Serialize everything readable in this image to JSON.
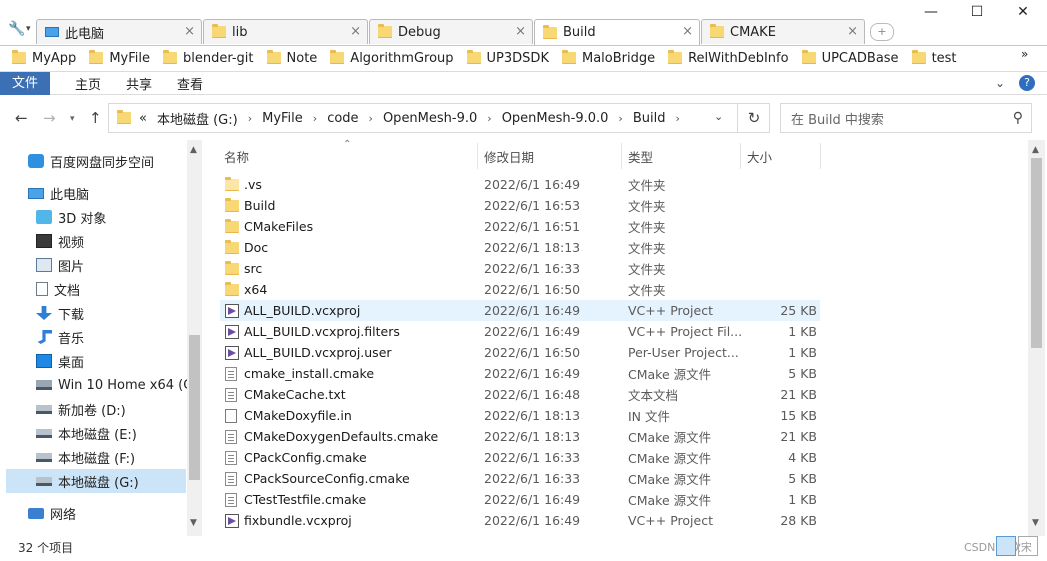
{
  "tabs": [
    {
      "label": "此电脑",
      "active": false,
      "icon": "computer-icon"
    },
    {
      "label": "lib",
      "active": false,
      "icon": "folder-icon"
    },
    {
      "label": "Debug",
      "active": false,
      "icon": "folder-icon"
    },
    {
      "label": "Build",
      "active": true,
      "icon": "folder-icon"
    },
    {
      "label": "CMAKE",
      "active": false,
      "icon": "folder-icon"
    }
  ],
  "window_controls": {
    "minimize": "—",
    "maximize": "☐",
    "close": "✕"
  },
  "bookmarks": [
    "MyApp",
    "MyFile",
    "blender-git",
    "Note",
    "AlgorithmGroup",
    "UP3DSDK",
    "MaloBridge",
    "RelWithDebInfo",
    "UPCADBase",
    "test"
  ],
  "bookmarks_more": "»",
  "ribbon": {
    "file": "文件",
    "tabs": [
      "主页",
      "共享",
      "查看"
    ]
  },
  "address": {
    "prefix": "«",
    "crumbs": [
      "本地磁盘 (G:)",
      "MyFile",
      "code",
      "OpenMesh-9.0",
      "OpenMesh-9.0.0",
      "Build"
    ]
  },
  "search": {
    "placeholder": "在 Build 中搜索"
  },
  "sidebar": {
    "items": [
      {
        "label": "百度网盘同步空间",
        "icon": "baidu-netdisk-icon",
        "indent": 1,
        "selected": false
      },
      {
        "label": "此电脑",
        "icon": "computer-icon",
        "indent": 1,
        "selected": false
      },
      {
        "label": "3D 对象",
        "icon": "3d-objects-icon",
        "indent": 2,
        "selected": false
      },
      {
        "label": "视频",
        "icon": "videos-icon",
        "indent": 2,
        "selected": false
      },
      {
        "label": "图片",
        "icon": "pictures-icon",
        "indent": 2,
        "selected": false
      },
      {
        "label": "文档",
        "icon": "documents-icon",
        "indent": 2,
        "selected": false
      },
      {
        "label": "下载",
        "icon": "downloads-icon",
        "indent": 2,
        "selected": false
      },
      {
        "label": "音乐",
        "icon": "music-icon",
        "indent": 2,
        "selected": false
      },
      {
        "label": "桌面",
        "icon": "desktop-icon",
        "indent": 2,
        "selected": false
      },
      {
        "label": "Win 10 Home x64 (C:)",
        "icon": "system-drive-icon",
        "indent": 2,
        "selected": false
      },
      {
        "label": "新加卷 (D:)",
        "icon": "drive-icon",
        "indent": 2,
        "selected": false
      },
      {
        "label": "本地磁盘 (E:)",
        "icon": "drive-icon",
        "indent": 2,
        "selected": false
      },
      {
        "label": "本地磁盘 (F:)",
        "icon": "drive-icon",
        "indent": 2,
        "selected": false
      },
      {
        "label": "本地磁盘 (G:)",
        "icon": "drive-icon",
        "indent": 2,
        "selected": true
      },
      {
        "label": "网络",
        "icon": "network-icon",
        "indent": 1,
        "selected": false
      }
    ]
  },
  "columns": {
    "name": "名称",
    "date": "修改日期",
    "type": "类型",
    "size": "大小"
  },
  "files": [
    {
      "name": ".vs",
      "date": "2022/6/1 16:49",
      "type": "文件夹",
      "size": "",
      "icon": "folder-icon",
      "kind": "folder-light"
    },
    {
      "name": "Build",
      "date": "2022/6/1 16:53",
      "type": "文件夹",
      "size": "",
      "icon": "folder-icon",
      "kind": "folder"
    },
    {
      "name": "CMakeFiles",
      "date": "2022/6/1 16:51",
      "type": "文件夹",
      "size": "",
      "icon": "folder-icon",
      "kind": "folder"
    },
    {
      "name": "Doc",
      "date": "2022/6/1 18:13",
      "type": "文件夹",
      "size": "",
      "icon": "folder-icon",
      "kind": "folder"
    },
    {
      "name": "src",
      "date": "2022/6/1 16:33",
      "type": "文件夹",
      "size": "",
      "icon": "folder-icon",
      "kind": "folder"
    },
    {
      "name": "x64",
      "date": "2022/6/1 16:50",
      "type": "文件夹",
      "size": "",
      "icon": "folder-icon",
      "kind": "folder"
    },
    {
      "name": "ALL_BUILD.vcxproj",
      "date": "2022/6/1 16:49",
      "type": "VC++ Project",
      "size": "25 KB",
      "icon": "vcxproj-icon",
      "kind": "vc",
      "hover": true
    },
    {
      "name": "ALL_BUILD.vcxproj.filters",
      "date": "2022/6/1 16:49",
      "type": "VC++ Project Fil...",
      "size": "1 KB",
      "icon": "vcxproj-filters-icon",
      "kind": "vc"
    },
    {
      "name": "ALL_BUILD.vcxproj.user",
      "date": "2022/6/1 16:50",
      "type": "Per-User Project...",
      "size": "1 KB",
      "icon": "vcxproj-user-icon",
      "kind": "vc"
    },
    {
      "name": "cmake_install.cmake",
      "date": "2022/6/1 16:49",
      "type": "CMake 源文件",
      "size": "5 KB",
      "icon": "cmake-file-icon",
      "kind": "cm"
    },
    {
      "name": "CMakeCache.txt",
      "date": "2022/6/1 16:48",
      "type": "文本文档",
      "size": "21 KB",
      "icon": "text-file-icon",
      "kind": "cm"
    },
    {
      "name": "CMakeDoxyfile.in",
      "date": "2022/6/1 18:13",
      "type": "IN 文件",
      "size": "15 KB",
      "icon": "file-icon",
      "kind": "doc"
    },
    {
      "name": "CMakeDoxygenDefaults.cmake",
      "date": "2022/6/1 18:13",
      "type": "CMake 源文件",
      "size": "21 KB",
      "icon": "cmake-file-icon",
      "kind": "cm"
    },
    {
      "name": "CPackConfig.cmake",
      "date": "2022/6/1 16:33",
      "type": "CMake 源文件",
      "size": "4 KB",
      "icon": "cmake-file-icon",
      "kind": "cm"
    },
    {
      "name": "CPackSourceConfig.cmake",
      "date": "2022/6/1 16:33",
      "type": "CMake 源文件",
      "size": "5 KB",
      "icon": "cmake-file-icon",
      "kind": "cm"
    },
    {
      "name": "CTestTestfile.cmake",
      "date": "2022/6/1 16:49",
      "type": "CMake 源文件",
      "size": "1 KB",
      "icon": "cmake-file-icon",
      "kind": "cm"
    },
    {
      "name": "fixbundle.vcxproj",
      "date": "2022/6/1 16:49",
      "type": "VC++ Project",
      "size": "28 KB",
      "icon": "vcxproj-icon",
      "kind": "vc"
    }
  ],
  "status": {
    "count": "32 个项目"
  },
  "watermark": "CSDN @钦宋"
}
